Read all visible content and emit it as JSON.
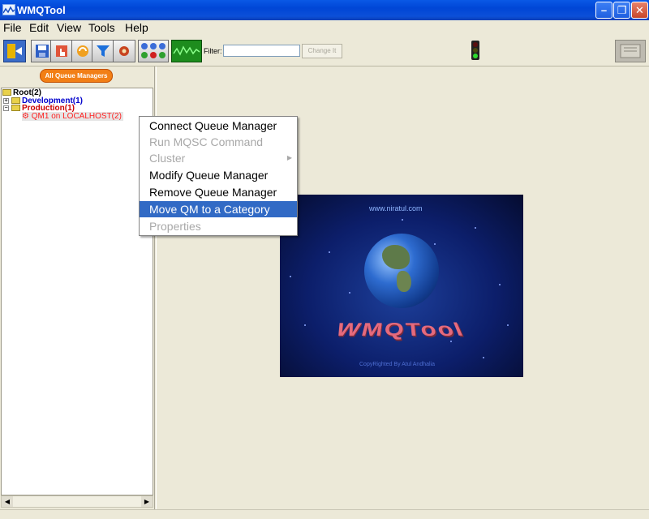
{
  "window": {
    "title": "WMQTool",
    "buttons": [
      "minimize",
      "restore",
      "close"
    ]
  },
  "menubar": {
    "items": [
      "File",
      "Edit",
      "View",
      "Tools",
      "Help"
    ]
  },
  "toolbar": {
    "icons": [
      "exit-icon",
      "save-icon",
      "hand-cursor-icon",
      "refresh-icon",
      "filter-icon",
      "settings-icon",
      "queue-status-icon",
      "monitor-graph-icon"
    ],
    "filter_label": "Filter:",
    "filter_value": "",
    "change_button": "Change It",
    "status_light": "green"
  },
  "left_panel": {
    "all_queue_managers_button": "All Queue Managers",
    "tree": {
      "root": "Root(2)",
      "development": "Development(1)",
      "production": "Production(1)",
      "qm1": "QM1 on LOCALHOST(2)"
    }
  },
  "context_menu": {
    "items": [
      {
        "label": "Connect Queue Manager",
        "enabled": true
      },
      {
        "label": "Run MQSC Command",
        "enabled": false
      },
      {
        "label": "Cluster",
        "enabled": false,
        "submenu": true
      },
      {
        "label": "Modify Queue Manager",
        "enabled": true
      },
      {
        "label": "Remove Queue Manager",
        "enabled": true
      },
      {
        "label": "Move QM to a Category",
        "enabled": true,
        "selected": true
      },
      {
        "label": "Properties",
        "enabled": false
      }
    ]
  },
  "splash": {
    "url": "www.niratul.com",
    "logo_text": "WMQTool",
    "copyright": "CopyRighted By Atul Andhalia"
  },
  "colors": {
    "titlebar": "#0A59E6",
    "selection": "#316AC5",
    "development_text": "#0000CC",
    "production_text": "#CC0000",
    "all_qm_button": "#F27F16"
  }
}
